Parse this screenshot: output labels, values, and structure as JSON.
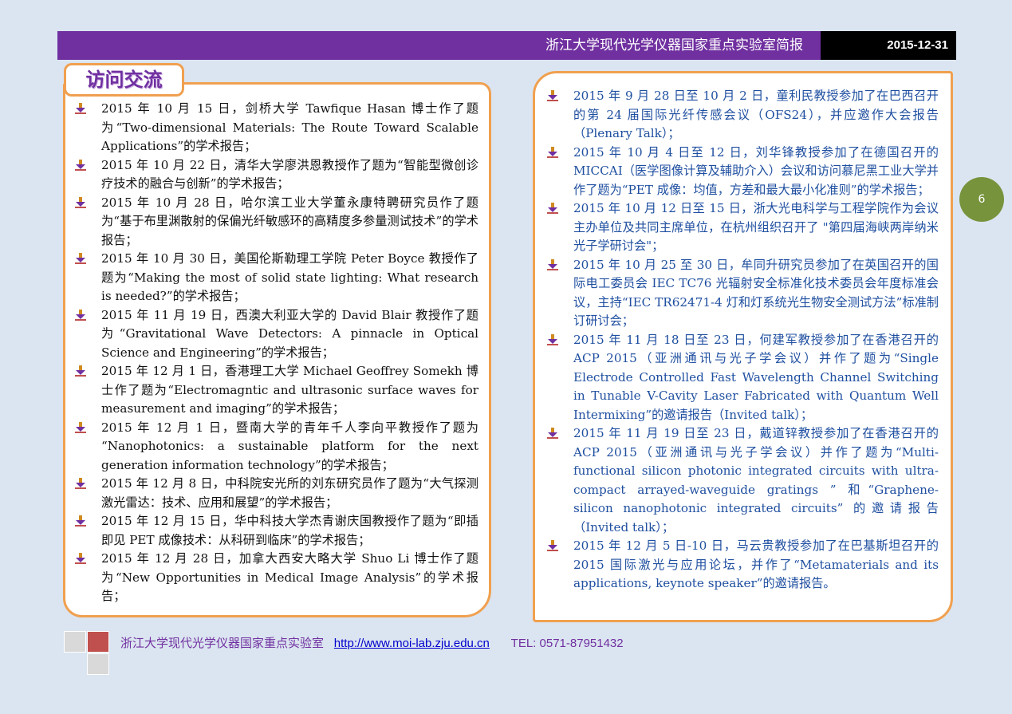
{
  "header": {
    "title": "浙江大学现代光学仪器国家重点实验室简报",
    "date": "2015-12-31"
  },
  "section": {
    "title": "访问交流"
  },
  "left_items": [
    "2015 年 10 月 15 日，剑桥大学 Tawfique Hasan 博士作了题为“Two-dimensional Materials: The Route Toward Scalable Applications”的学术报告；",
    "2015 年 10 月 22 日，清华大学廖洪恩教授作了题为“智能型微创诊疗技术的融合与创新”的学术报告；",
    "2015 年 10 月 28 日，哈尔滨工业大学董永康特聘研究员作了题为“基于布里渊散射的保偏光纤敏感环的高精度多参量测试技术”的学术报告；",
    "2015 年 10 月 30 日，美国伦斯勒理工学院 Peter Boyce 教授作了题为“Making the most of solid state lighting: What research is needed?”的学术报告；",
    "2015 年 11 月 19 日，西澳大利亚大学的 David Blair 教授作了题为“Gravitational Wave Detectors: A pinnacle in Optical Science and Engineering”的学术报告；",
    "2015 年 12 月 1 日，香港理工大学 Michael Geoffrey Somekh 博士作了题为“Electromagntic and ultrasonic surface waves for measurement and imaging”的学术报告；",
    "2015 年 12 月 1 日，暨南大学的青年千人李向平教授作了题为 “Nanophotonics: a sustainable platform for the next generation information technology”的学术报告；",
    "2015 年 12 月 8 日，中科院安光所的刘东研究员作了题为“大气探测激光雷达：技术、应用和展望”的学术报告；",
    "2015 年 12 月 15 日，华中科技大学杰青谢庆国教授作了题为“即插即见 PET 成像技术：从科研到临床”的学术报告；",
    "2015 年 12 月 28 日，加拿大西安大略大学 Shuo Li 博士作了题为“New Opportunities in Medical Image Analysis”的学术报告；"
  ],
  "right_items": [
    "2015 年 9 月 28 日至 10 月 2 日，童利民教授参加了在巴西召开的第 24 届国际光纤传感会议（OFS24），并应邀作大会报告（Plenary Talk）；",
    "2015 年 10 月 4 日至 12 日，刘华锋教授参加了在德国召开的 MICCAI（医学图像计算及辅助介入）会议和访问慕尼黑工业大学并作了题为“PET 成像：均值，方差和最大最小化准则”的学术报告；",
    "2015 年 10 月 12 日至 15 日，浙大光电科学与工程学院作为会议主办单位及共同主席单位，在杭州组织召开了 \"第四届海峡两岸纳米光子学研讨会\"；",
    "2015 年 10 月 25 至 30 日，牟同升研究员参加了在英国召开的国际电工委员会 IEC TC76 光辐射安全标准化技术委员会年度标准会议，主持“IEC TR62471-4 灯和灯系统光生物安全测试方法”标准制订研讨会；",
    "2015 年 11 月 18 日至 23 日，何建军教授参加了在香港召开的 ACP 2015（亚洲通讯与光子学会议）并作了题为“Single Electrode Controlled Fast Wavelength Channel Switching in Tunable V-Cavity Laser Fabricated with Quantum Well Intermixing”的邀请报告（Invited talk）；",
    "2015 年 11 月 19 日至 23 日，戴道锌教授参加了在香港召开的 ACP 2015（亚洲通讯与光子学会议）并作了题为“Multi-functional silicon photonic integrated circuits with ultra-compact arrayed-waveguide gratings ” 和“Graphene-silicon nanophotonic integrated circuits” 的邀请报告（Invited talk）；",
    "2015 年 12 月 5 日-10 日，马云贵教授参加了在巴基斯坦召开的 2015 国际激光与应用论坛，并作了“Metamaterials and its applications, keynote speaker”的邀请报告。"
  ],
  "page_number": "6",
  "footer": {
    "org": "浙江大学现代光学仪器国家重点实验室",
    "url": "http://www.moi-lab.zju.edu.cn",
    "tel": "TEL: 0571-87951432"
  },
  "colors": {
    "header_purple": "#7030a0",
    "panel_border": "#f0a050",
    "page_badge": "#77933c",
    "right_text": "#1f4fa0",
    "background": "#dbe5f1"
  },
  "icons": {
    "bullet": "arrow-down-bullet-icon"
  }
}
